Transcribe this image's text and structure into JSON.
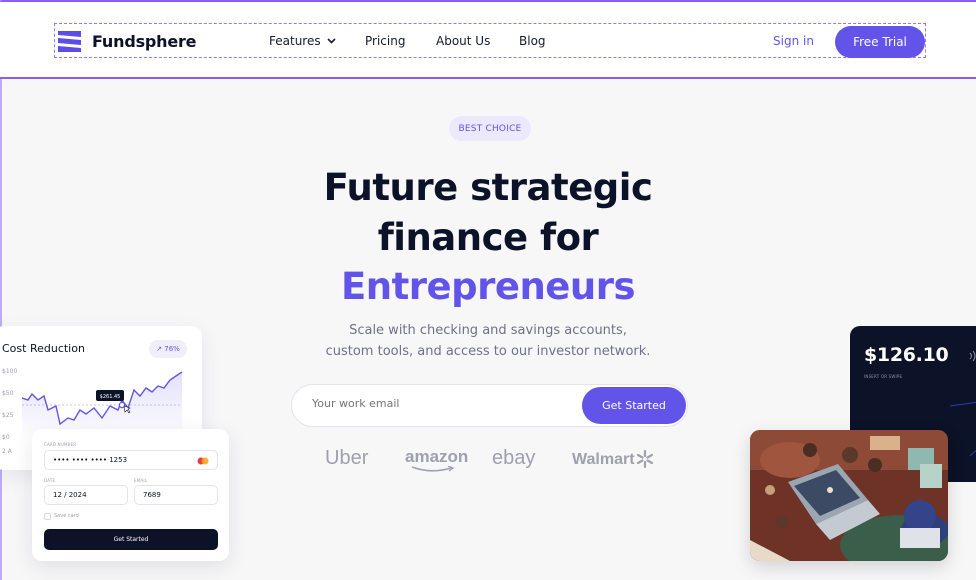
{
  "nav": {
    "brand": "Fundsphere",
    "links": [
      "Features",
      "Pricing",
      "About Us",
      "Blog"
    ],
    "sign_in": "Sign in",
    "cta": "Free Trial"
  },
  "hero": {
    "badge": "BEST CHOICE",
    "title_line1": "Future strategic",
    "title_line2": "finance for",
    "title_accent": "Entrepreneurs",
    "subtitle_line1": "Scale with checking and savings accounts,",
    "subtitle_line2": "custom tools, and access to our investor network.",
    "email_placeholder": "Your work email",
    "cta": "Get Started"
  },
  "brands": [
    "Uber",
    "amazon",
    "ebay",
    "Walmart"
  ],
  "cost_card": {
    "title": "Cost Reduction",
    "change": "↗ 76%",
    "y_ticks": [
      "$100",
      "$50",
      "$25",
      "$0"
    ],
    "tooltip": "$261.45",
    "x_first": "2 A"
  },
  "payment_card": {
    "card_label": "CARD NUMBER",
    "card_value": "•••• •••• ••••  1253",
    "date_label": "DATE",
    "date_value": "12 / 2024",
    "email_label": "EMAIL",
    "email_value": "7689",
    "save_label": "Save card",
    "button": "Get Started"
  },
  "balance_card": {
    "amount": "$126.10",
    "label": "INSERT OR SWIPE"
  },
  "colors": {
    "accent": "#6254e8",
    "dark": "#0c1227",
    "muted": "#6f7185",
    "frame": "#8b5cf6"
  }
}
